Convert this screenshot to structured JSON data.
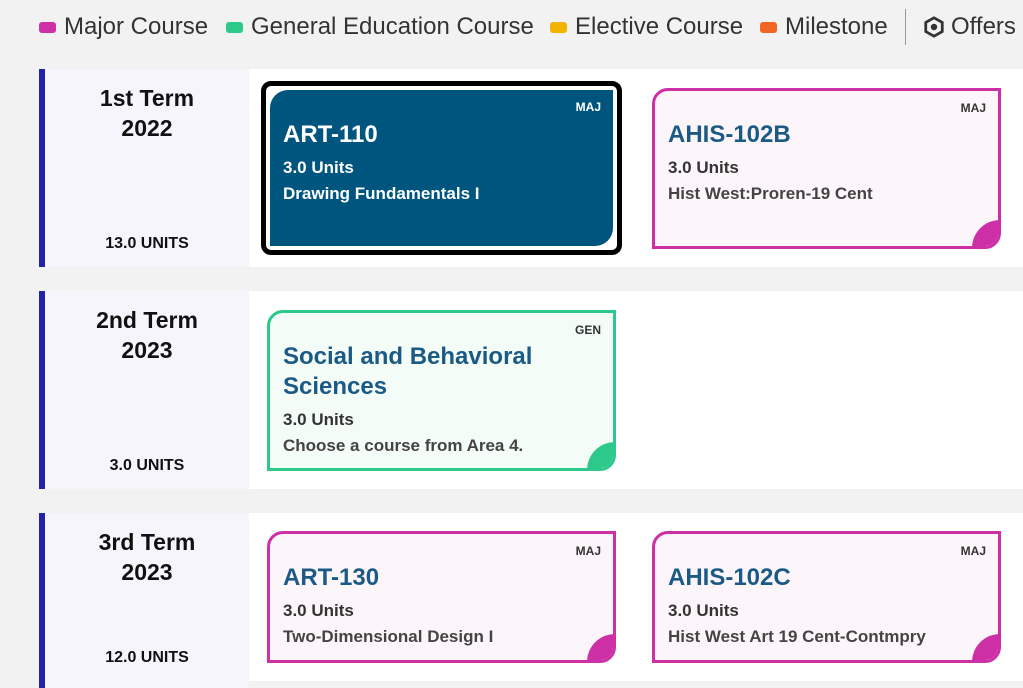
{
  "legend": {
    "items": [
      {
        "label": "Major Course",
        "color": "#cc2fa6"
      },
      {
        "label": "General Education Course",
        "color": "#2cc98a"
      },
      {
        "label": "Elective Course",
        "color": "#f0b400"
      },
      {
        "label": "Milestone",
        "color": "#f26522"
      }
    ],
    "offers_label": "Offers"
  },
  "terms": [
    {
      "title_line1": "1st Term",
      "title_line2": "2022",
      "units": "13.0 UNITS",
      "courses": [
        {
          "tag": "MAJ",
          "code": "ART-110",
          "units": "3.0 Units",
          "name": "Drawing Fundamentals I",
          "selected": true
        },
        {
          "tag": "MAJ",
          "code": "AHIS-102B",
          "units": "3.0 Units",
          "name": "Hist West:Proren-19 Cent"
        }
      ]
    },
    {
      "title_line1": "2nd Term",
      "title_line2": "2023",
      "units": "3.0 UNITS",
      "courses": [
        {
          "tag": "GEN",
          "code": "Social and Behavioral Sciences",
          "units": "3.0 Units",
          "name": "Choose a course from Area 4."
        }
      ]
    },
    {
      "title_line1": "3rd Term",
      "title_line2": "2023",
      "units": "12.0 UNITS",
      "courses": [
        {
          "tag": "MAJ",
          "code": "ART-130",
          "units": "3.0 Units",
          "name": "Two-Dimensional Design I"
        },
        {
          "tag": "MAJ",
          "code": "AHIS-102C",
          "units": "3.0 Units",
          "name": "Hist West Art 19 Cent-Contmpry"
        }
      ]
    }
  ]
}
